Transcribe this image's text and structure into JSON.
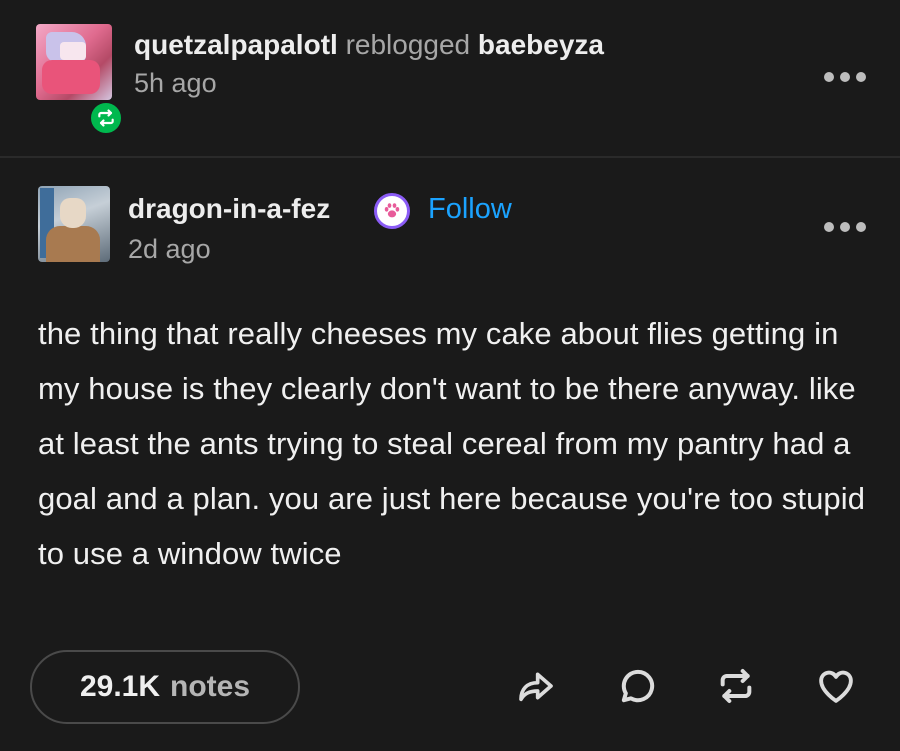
{
  "reblog": {
    "reblogger": "quetzalpapalotl",
    "action": "reblogged",
    "source": "baebeyza",
    "time": "5h ago"
  },
  "post": {
    "author": "dragon-in-a-fez",
    "follow_label": "Follow",
    "time": "2d ago",
    "body": "the thing that really cheeses my cake about flies getting in my house is they clearly don't want to be there anyway. like at least the ants trying to steal cereal from my pantry had a goal and a plan. you are just here because you're too stupid to use a window twice"
  },
  "footer": {
    "notes_count": "29.1K",
    "notes_label": "notes"
  },
  "colors": {
    "background": "#1a1a1a",
    "follow_accent": "#1ba3ff",
    "reblog_badge": "#00b84e",
    "paw_badge_ring": "#8b5cf6"
  },
  "icons": [
    "reblog-icon",
    "more-icon",
    "paw-badge-icon",
    "share-icon",
    "reply-icon",
    "reblog-icon",
    "heart-icon"
  ]
}
